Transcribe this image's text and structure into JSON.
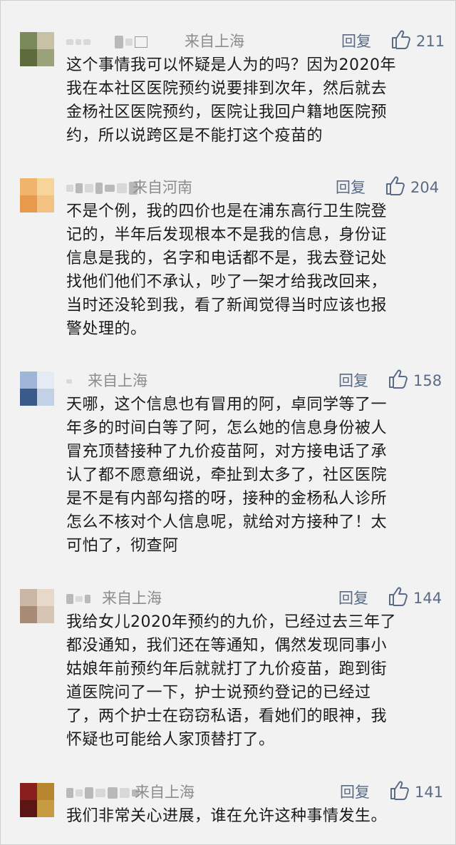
{
  "comments": [
    {
      "location": "来自上海",
      "reply_label": "回复",
      "likes": "211",
      "avatar_colors": [
        "#7a8a5a",
        "#c9c1a6",
        "#5e6b3c",
        "#9aa27a"
      ],
      "lines": [
        "这个事情我可以怀疑是人为的吗？因为2020年",
        "我在本社区医院预约说要排到次年，然后就去",
        "金杨社区医院预约，医院让我回户籍地医院预",
        "约，所以说跨区是不能打这个疫苗的"
      ]
    },
    {
      "location": "来自河南",
      "reply_label": "回复",
      "likes": "204",
      "avatar_colors": [
        "#f0b46a",
        "#f6d49a",
        "#e89a4c",
        "#f3c283"
      ],
      "lines": [
        "不是个例，我的四价也是在浦东高行卫生院登",
        "记的，半年后发现根本不是我的信息，身份证",
        "信息是我的，名字和电话都不是，我去登记处",
        "找他们他们不承认，吵了一架才给我改回来，",
        "当时还没轮到我，看了新闻觉得当时应该也报",
        "警处理的。"
      ]
    },
    {
      "location": "来自上海",
      "reply_label": "回复",
      "likes": "158",
      "avatar_colors": [
        "#9fb6d8",
        "#e4ebf4",
        "#3a5a8c",
        "#c3d1e6"
      ],
      "lines": [
        "天哪，这个信息也有冒用的阿，卓同学等了一",
        "年多的时间白等了阿，怎么她的信息身份被人",
        "冒充顶替接种了九价疫苗阿，对方接电话了承",
        "认了都不愿意细说，牵扯到太多了，社区医院",
        "是不是有内部勾搭的呀，接种的金杨私人诊所",
        "怎么不核对个人信息呢，就给对方接种了！太",
        "可怕了，彻查阿"
      ]
    },
    {
      "location": "来自上海",
      "reply_label": "回复",
      "likes": "144",
      "avatar_colors": [
        "#c9b6a4",
        "#e6d8ca",
        "#a88b74",
        "#d8c4b2"
      ],
      "lines": [
        "我给女儿2020年预约的九价，已经过去三年了",
        "都没通知，我们还在等通知，偶然发现同事小",
        "姑娘年前预约年后就就打了九价疫苗，跑到街",
        "道医院问了一下，护士说预约登记的已经过",
        "了，两个护士在窃窃私语，看她们的眼神，我",
        "怀疑也可能给人家顶替打了。"
      ]
    },
    {
      "location": "来自上海",
      "reply_label": "回复",
      "likes": "141",
      "avatar_colors": [
        "#8a1e1e",
        "#b8862e",
        "#5c1414",
        "#c79a44"
      ],
      "lines": [
        "我们非常关心进展，谁在允许这种事情发生。"
      ]
    }
  ]
}
